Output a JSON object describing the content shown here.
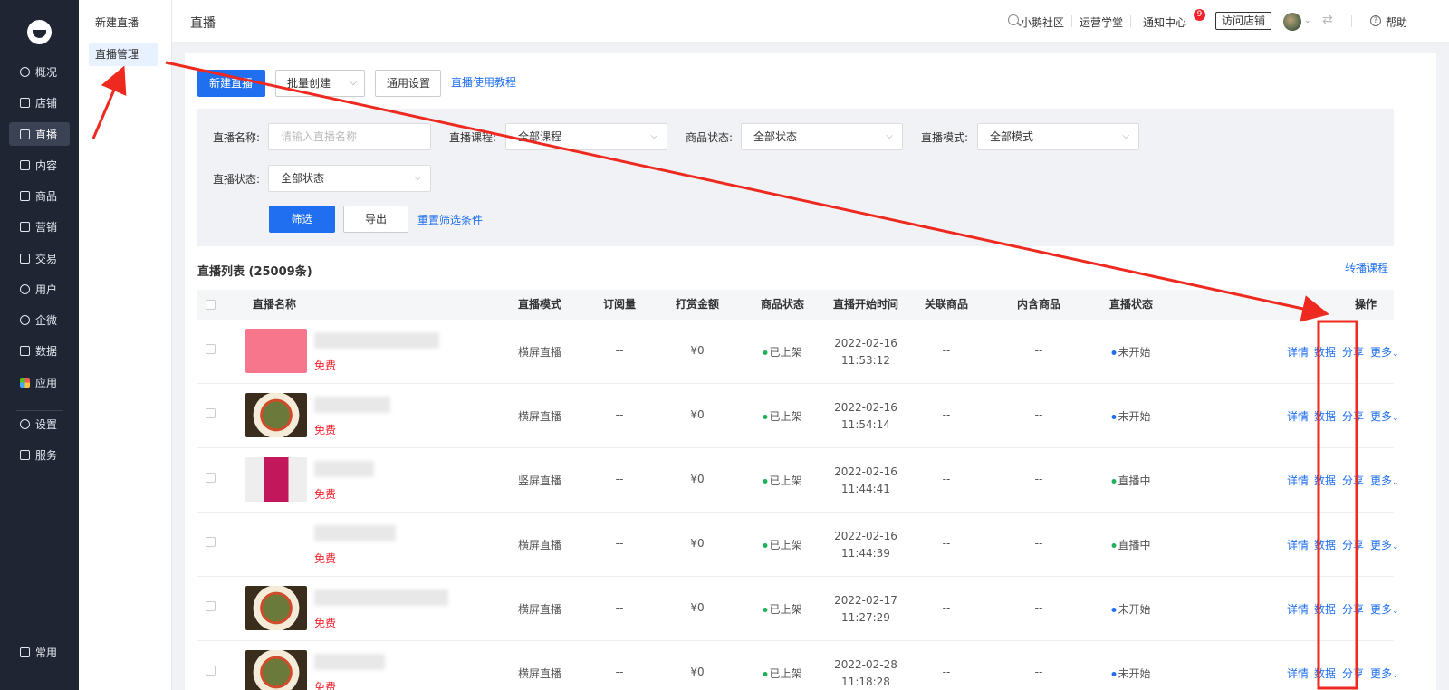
{
  "nav": {
    "items": [
      {
        "label": "概况",
        "icon": "overview-icon"
      },
      {
        "label": "店铺",
        "icon": "shop-icon"
      },
      {
        "label": "直播",
        "icon": "live-icon"
      },
      {
        "label": "内容",
        "icon": "content-icon"
      },
      {
        "label": "商品",
        "icon": "goods-icon"
      },
      {
        "label": "营销",
        "icon": "marketing-icon"
      },
      {
        "label": "交易",
        "icon": "trade-icon"
      },
      {
        "label": "用户",
        "icon": "user-icon"
      },
      {
        "label": "企微",
        "icon": "wecom-icon"
      },
      {
        "label": "数据",
        "icon": "data-icon"
      },
      {
        "label": "应用",
        "icon": "apps-icon"
      },
      {
        "label": "设置",
        "icon": "settings-icon"
      },
      {
        "label": "服务",
        "icon": "service-icon"
      },
      {
        "label": "常用",
        "icon": "common-icon"
      }
    ],
    "active": "直播"
  },
  "subnav": {
    "items": [
      "新建直播",
      "直播管理"
    ],
    "active": "直播管理"
  },
  "header": {
    "title": "直播",
    "community": "小鹅社区",
    "academy": "运营学堂",
    "notifications": "通知中心",
    "notification_count": "9",
    "visit_shop": "访问店铺",
    "help": "帮助"
  },
  "toolbar": {
    "new_live": "新建直播",
    "batch_create": "批量创建",
    "general_settings": "通用设置",
    "tutorial": "直播使用教程"
  },
  "filters": {
    "name_label": "直播名称:",
    "name_placeholder": "请输入直播名称",
    "course_label": "直播课程:",
    "course_value": "全部课程",
    "goods_status_label": "商品状态:",
    "goods_status_value": "全部状态",
    "mode_label": "直播模式:",
    "mode_value": "全部模式",
    "live_status_label": "直播状态:",
    "live_status_value": "全部状态",
    "filter_button": "筛选",
    "export_button": "导出",
    "reset_link": "重置筛选条件"
  },
  "list": {
    "title": "直播列表 (25009条)",
    "transfer_link": "转播课程",
    "columns": [
      "直播名称",
      "直播模式",
      "订阅量",
      "打赏金额",
      "商品状态",
      "直播开始时间",
      "关联商品",
      "内含商品",
      "直播状态",
      "操作"
    ],
    "rows": [
      {
        "price": "免费",
        "mode": "横屏直播",
        "subs": "--",
        "reward": "¥0",
        "goods_status": "已上架",
        "date": "2022-02-16",
        "time": "11:53:12",
        "linked": "--",
        "included": "--",
        "status": "未开始"
      },
      {
        "price": "免费",
        "mode": "横屏直播",
        "subs": "--",
        "reward": "¥0",
        "goods_status": "已上架",
        "date": "2022-02-16",
        "time": "11:54:14",
        "linked": "--",
        "included": "--",
        "status": "未开始"
      },
      {
        "price": "免费",
        "mode": "竖屏直播",
        "subs": "--",
        "reward": "¥0",
        "goods_status": "已上架",
        "date": "2022-02-16",
        "time": "11:44:41",
        "linked": "--",
        "included": "--",
        "status": "直播中"
      },
      {
        "price": "免费",
        "mode": "横屏直播",
        "subs": "--",
        "reward": "¥0",
        "goods_status": "已上架",
        "date": "2022-02-16",
        "time": "11:44:39",
        "linked": "--",
        "included": "--",
        "status": "直播中"
      },
      {
        "price": "免费",
        "mode": "横屏直播",
        "subs": "--",
        "reward": "¥0",
        "goods_status": "已上架",
        "date": "2022-02-17",
        "time": "11:27:29",
        "linked": "--",
        "included": "--",
        "status": "未开始"
      },
      {
        "price": "免费",
        "mode": "横屏直播",
        "subs": "--",
        "reward": "¥0",
        "goods_status": "已上架",
        "date": "2022-02-28",
        "time": "11:18:28",
        "linked": "--",
        "included": "--",
        "status": "未开始"
      }
    ],
    "actions": {
      "detail": "详情",
      "data": "数据",
      "share": "分享",
      "more": "更多"
    }
  },
  "colors": {
    "primary": "#1f6ff0",
    "nav_bg": "#1f2533",
    "free": "#f5222d",
    "on_shelf_dot": "#20b15a",
    "not_started_dot": "#1f6ff0",
    "live_dot": "#20b15a",
    "annotation": "#ee2a20"
  }
}
